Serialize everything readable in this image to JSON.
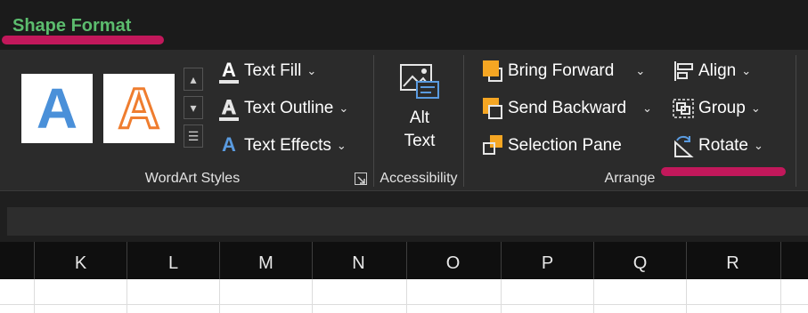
{
  "tab": {
    "title": "Shape Format"
  },
  "wordart_styles": {
    "label": "WordArt Styles",
    "presets": [
      {
        "letter": "A",
        "style": "blue-fill",
        "color": "#4a90d9"
      },
      {
        "letter": "A",
        "style": "orange-outline",
        "color": "#ef7d2f"
      }
    ],
    "text_fill": "Text Fill",
    "text_outline": "Text Outline",
    "text_effects": "Text Effects",
    "text_fill_icon": "A",
    "text_outline_icon": "A",
    "text_effects_icon": "A"
  },
  "accessibility": {
    "label": "Accessibility",
    "alt_text_line1": "Alt",
    "alt_text_line2": "Text"
  },
  "arrange": {
    "label": "Arrange",
    "bring_forward": "Bring Forward",
    "send_backward": "Send Backward",
    "selection_pane": "Selection Pane",
    "align": "Align",
    "group": "Group",
    "rotate": "Rotate"
  },
  "columns": [
    "K",
    "L",
    "M",
    "N",
    "O",
    "P",
    "Q",
    "R"
  ],
  "colors": {
    "tab_title": "#5cbc6e",
    "annotation": "#c2185b",
    "ribbon_bg": "#2b2b2b",
    "accent_orange": "#f5a623"
  }
}
